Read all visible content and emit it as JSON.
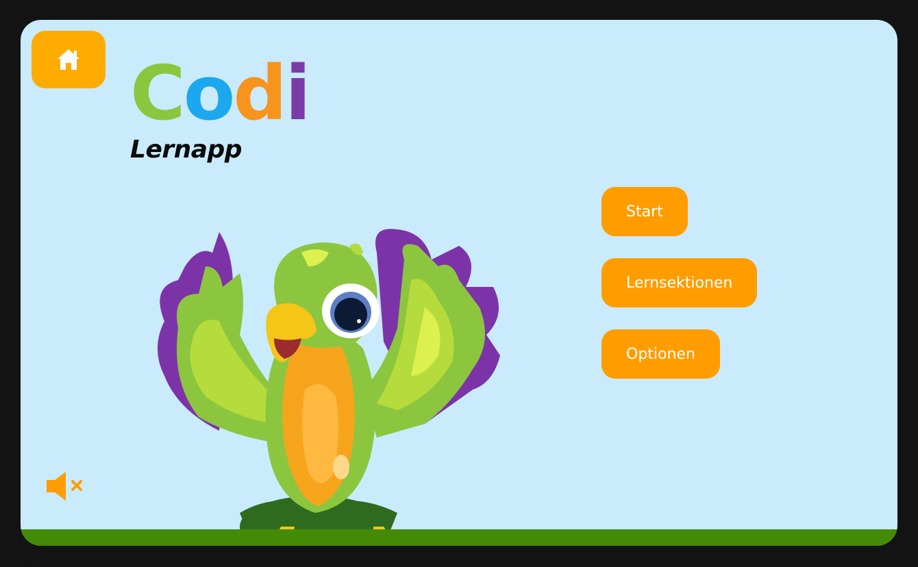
{
  "colors": {
    "frame": "#131313",
    "background": "#c9ebfc",
    "grass": "#438a07",
    "button": "#ff9d00",
    "home_button": "#ffab00",
    "button_text": "#ffffff",
    "logo_c": "#8cc63f",
    "logo_o": "#1ba8ee",
    "logo_d": "#f7941d",
    "logo_i": "#7b3aa8"
  },
  "header": {
    "home_icon": "home-icon"
  },
  "logo": {
    "letters": [
      "C",
      "o",
      "d",
      "i"
    ],
    "subtitle": "Lernapp"
  },
  "menu": {
    "items": [
      {
        "label": "Start"
      },
      {
        "label": "Lernsektionen"
      },
      {
        "label": "Optionen"
      }
    ]
  },
  "sound": {
    "icon": "speaker-muted-icon",
    "muted": true
  },
  "mascot": {
    "icon": "parrot-mascot"
  }
}
